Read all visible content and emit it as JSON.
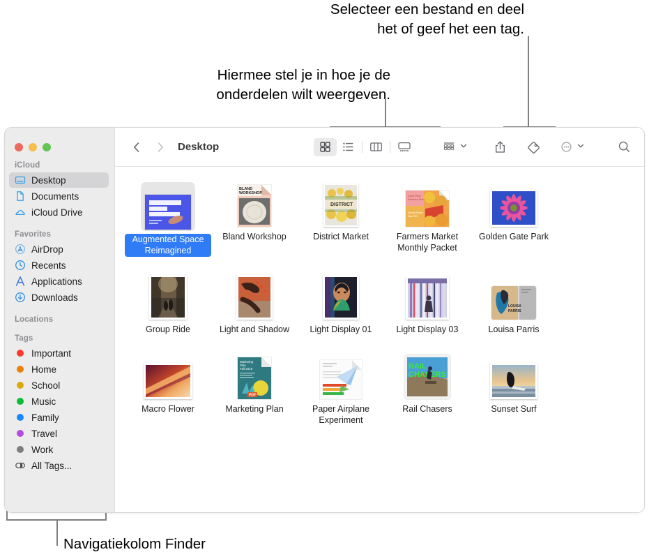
{
  "callouts": {
    "share": "Selecteer een bestand en deel\nhet of geef het een tag.",
    "view": "Hiermee stel je in hoe je de\nonderdelen wilt weergeven.",
    "sidebar": "Navigatiekolom Finder"
  },
  "window": {
    "title": "Desktop",
    "traffic_lights": {
      "close": "#ED6A5E",
      "minimize": "#F5BE4F",
      "zoom": "#62C554"
    }
  },
  "sidebar": {
    "sections": [
      {
        "heading": "iCloud",
        "items": [
          {
            "label": "Desktop",
            "icon": "desktop-icon",
            "selected": true
          },
          {
            "label": "Documents",
            "icon": "document-icon",
            "selected": false
          },
          {
            "label": "iCloud Drive",
            "icon": "cloud-icon",
            "selected": false
          }
        ]
      },
      {
        "heading": "Favorites",
        "items": [
          {
            "label": "AirDrop",
            "icon": "airdrop-icon",
            "selected": false
          },
          {
            "label": "Recents",
            "icon": "clock-icon",
            "selected": false
          },
          {
            "label": "Applications",
            "icon": "applications-icon",
            "selected": false
          },
          {
            "label": "Downloads",
            "icon": "download-icon",
            "selected": false
          }
        ]
      },
      {
        "heading": "Locations",
        "items": []
      },
      {
        "heading": "Tags",
        "items": [
          {
            "label": "Important",
            "icon": "tag-dot",
            "color": "#FC3B2D"
          },
          {
            "label": "Home",
            "icon": "tag-dot",
            "color": "#E8820C"
          },
          {
            "label": "School",
            "icon": "tag-dot",
            "color": "#DBA90A"
          },
          {
            "label": "Music",
            "icon": "tag-dot",
            "color": "#0FBB35"
          },
          {
            "label": "Family",
            "icon": "tag-dot",
            "color": "#1988FC"
          },
          {
            "label": "Travel",
            "icon": "tag-dot",
            "color": "#B martial"
          },
          {
            "label": "Work",
            "icon": "tag-dot",
            "color": "#7E7E82"
          },
          {
            "label": "All Tags...",
            "icon": "all-tags-icon",
            "color": ""
          }
        ]
      }
    ]
  },
  "toolbar": {
    "back": "‹",
    "forward": "›",
    "view_buttons": [
      {
        "name": "icon-view",
        "selected": true
      },
      {
        "name": "list-view",
        "selected": false
      },
      {
        "name": "column-view",
        "selected": false
      },
      {
        "name": "gallery-view",
        "selected": false
      }
    ],
    "group_by": "group-by-icon",
    "share": "share-icon",
    "tag": "tag-icon",
    "more": "more-actions-icon",
    "search": "search-icon"
  },
  "files": [
    {
      "name": "Augmented Space Reimagined",
      "selected": true,
      "kind": "keynote"
    },
    {
      "name": "Bland Workshop",
      "selected": false,
      "kind": "pages-bw"
    },
    {
      "name": "District Market",
      "selected": false,
      "kind": "photo-district"
    },
    {
      "name": "Farmers Market Monthly Packet",
      "selected": false,
      "kind": "pages-farmers"
    },
    {
      "name": "Golden Gate Park",
      "selected": false,
      "kind": "photo-flower-purple"
    },
    {
      "name": "Group Ride",
      "selected": false,
      "kind": "photo-ride"
    },
    {
      "name": "Light and Shadow",
      "selected": false,
      "kind": "photo-hand"
    },
    {
      "name": "Light Display 01",
      "selected": false,
      "kind": "photo-face"
    },
    {
      "name": "Light Display 03",
      "selected": false,
      "kind": "photo-stripes"
    },
    {
      "name": "Louisa Parris",
      "selected": false,
      "kind": "photo-louisa"
    },
    {
      "name": "Macro Flower",
      "selected": false,
      "kind": "photo-macro"
    },
    {
      "name": "Marketing Plan",
      "selected": false,
      "kind": "pdf-marketing"
    },
    {
      "name": "Paper Airplane Experiment",
      "selected": false,
      "kind": "numbers-doc"
    },
    {
      "name": "Rail Chasers",
      "selected": false,
      "kind": "photo-rail"
    },
    {
      "name": "Sunset Surf",
      "selected": false,
      "kind": "photo-surf"
    }
  ]
}
